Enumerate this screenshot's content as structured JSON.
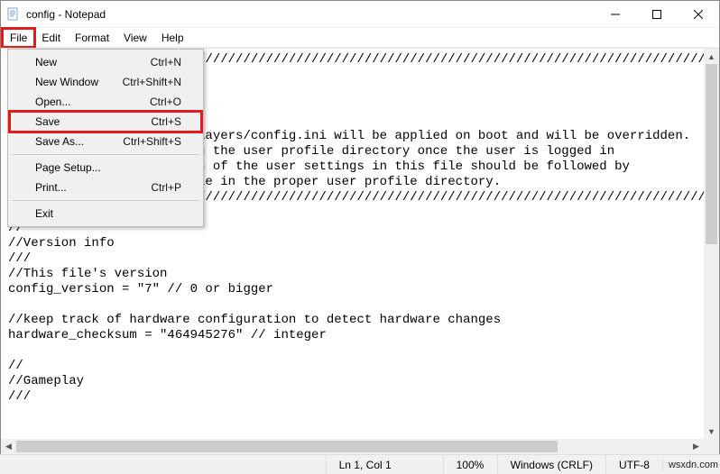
{
  "window": {
    "title": "config - Notepad"
  },
  "menubar": {
    "file": "File",
    "edit": "Edit",
    "format": "Format",
    "view": "View",
    "help": "Help"
  },
  "file_menu": {
    "new": {
      "label": "New",
      "shortcut": "Ctrl+N"
    },
    "new_window": {
      "label": "New Window",
      "shortcut": "Ctrl+Shift+N"
    },
    "open": {
      "label": "Open...",
      "shortcut": "Ctrl+O"
    },
    "save": {
      "label": "Save",
      "shortcut": "Ctrl+S"
    },
    "save_as": {
      "label": "Save As...",
      "shortcut": "Ctrl+Shift+S"
    },
    "page_setup": {
      "label": "Page Setup...",
      "shortcut": ""
    },
    "print": {
      "label": "Print...",
      "shortcut": "Ctrl+P"
    },
    "exit": {
      "label": "Exit",
      "shortcut": ""
    }
  },
  "editor": {
    "content": "///////////////////////////////////////////////////////////////////////////////////////////////////\n///\n//Anno 1800 - config.ini\n///\n//\n//The settings found in players/config.ini will be applied on boot and will be overridden.\n//by the settings found in the user profile directory once the user is logged in\n//Accordingly, the edition of the user settings in this file should be followed by\n//a copy of the config file in the proper user profile directory.\n///////////////////////////////////////////////////////////////////////////////////////////////////\n\n//\n//Version info\n///\n//This file's version\nconfig_version = \"7\" // 0 or bigger\n\n//keep track of hardware configuration to detect hardware changes\nhardware_checksum = \"464945276\" // integer\n\n//\n//Gameplay\n///"
  },
  "statusbar": {
    "position": "Ln 1, Col 1",
    "zoom": "100%",
    "line_ending": "Windows (CRLF)",
    "encoding": "UTF-8",
    "watermark": "wsxdn.com"
  }
}
